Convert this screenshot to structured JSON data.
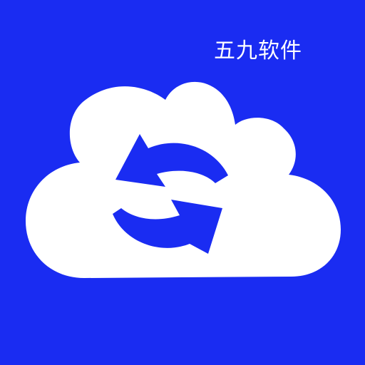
{
  "app": {
    "brand_text": "五九软件",
    "icon": "cloud-sync-icon"
  },
  "colors": {
    "background": "#1a2cf2",
    "cloud": "#ffffff",
    "arrows": "#1a2cf2"
  }
}
